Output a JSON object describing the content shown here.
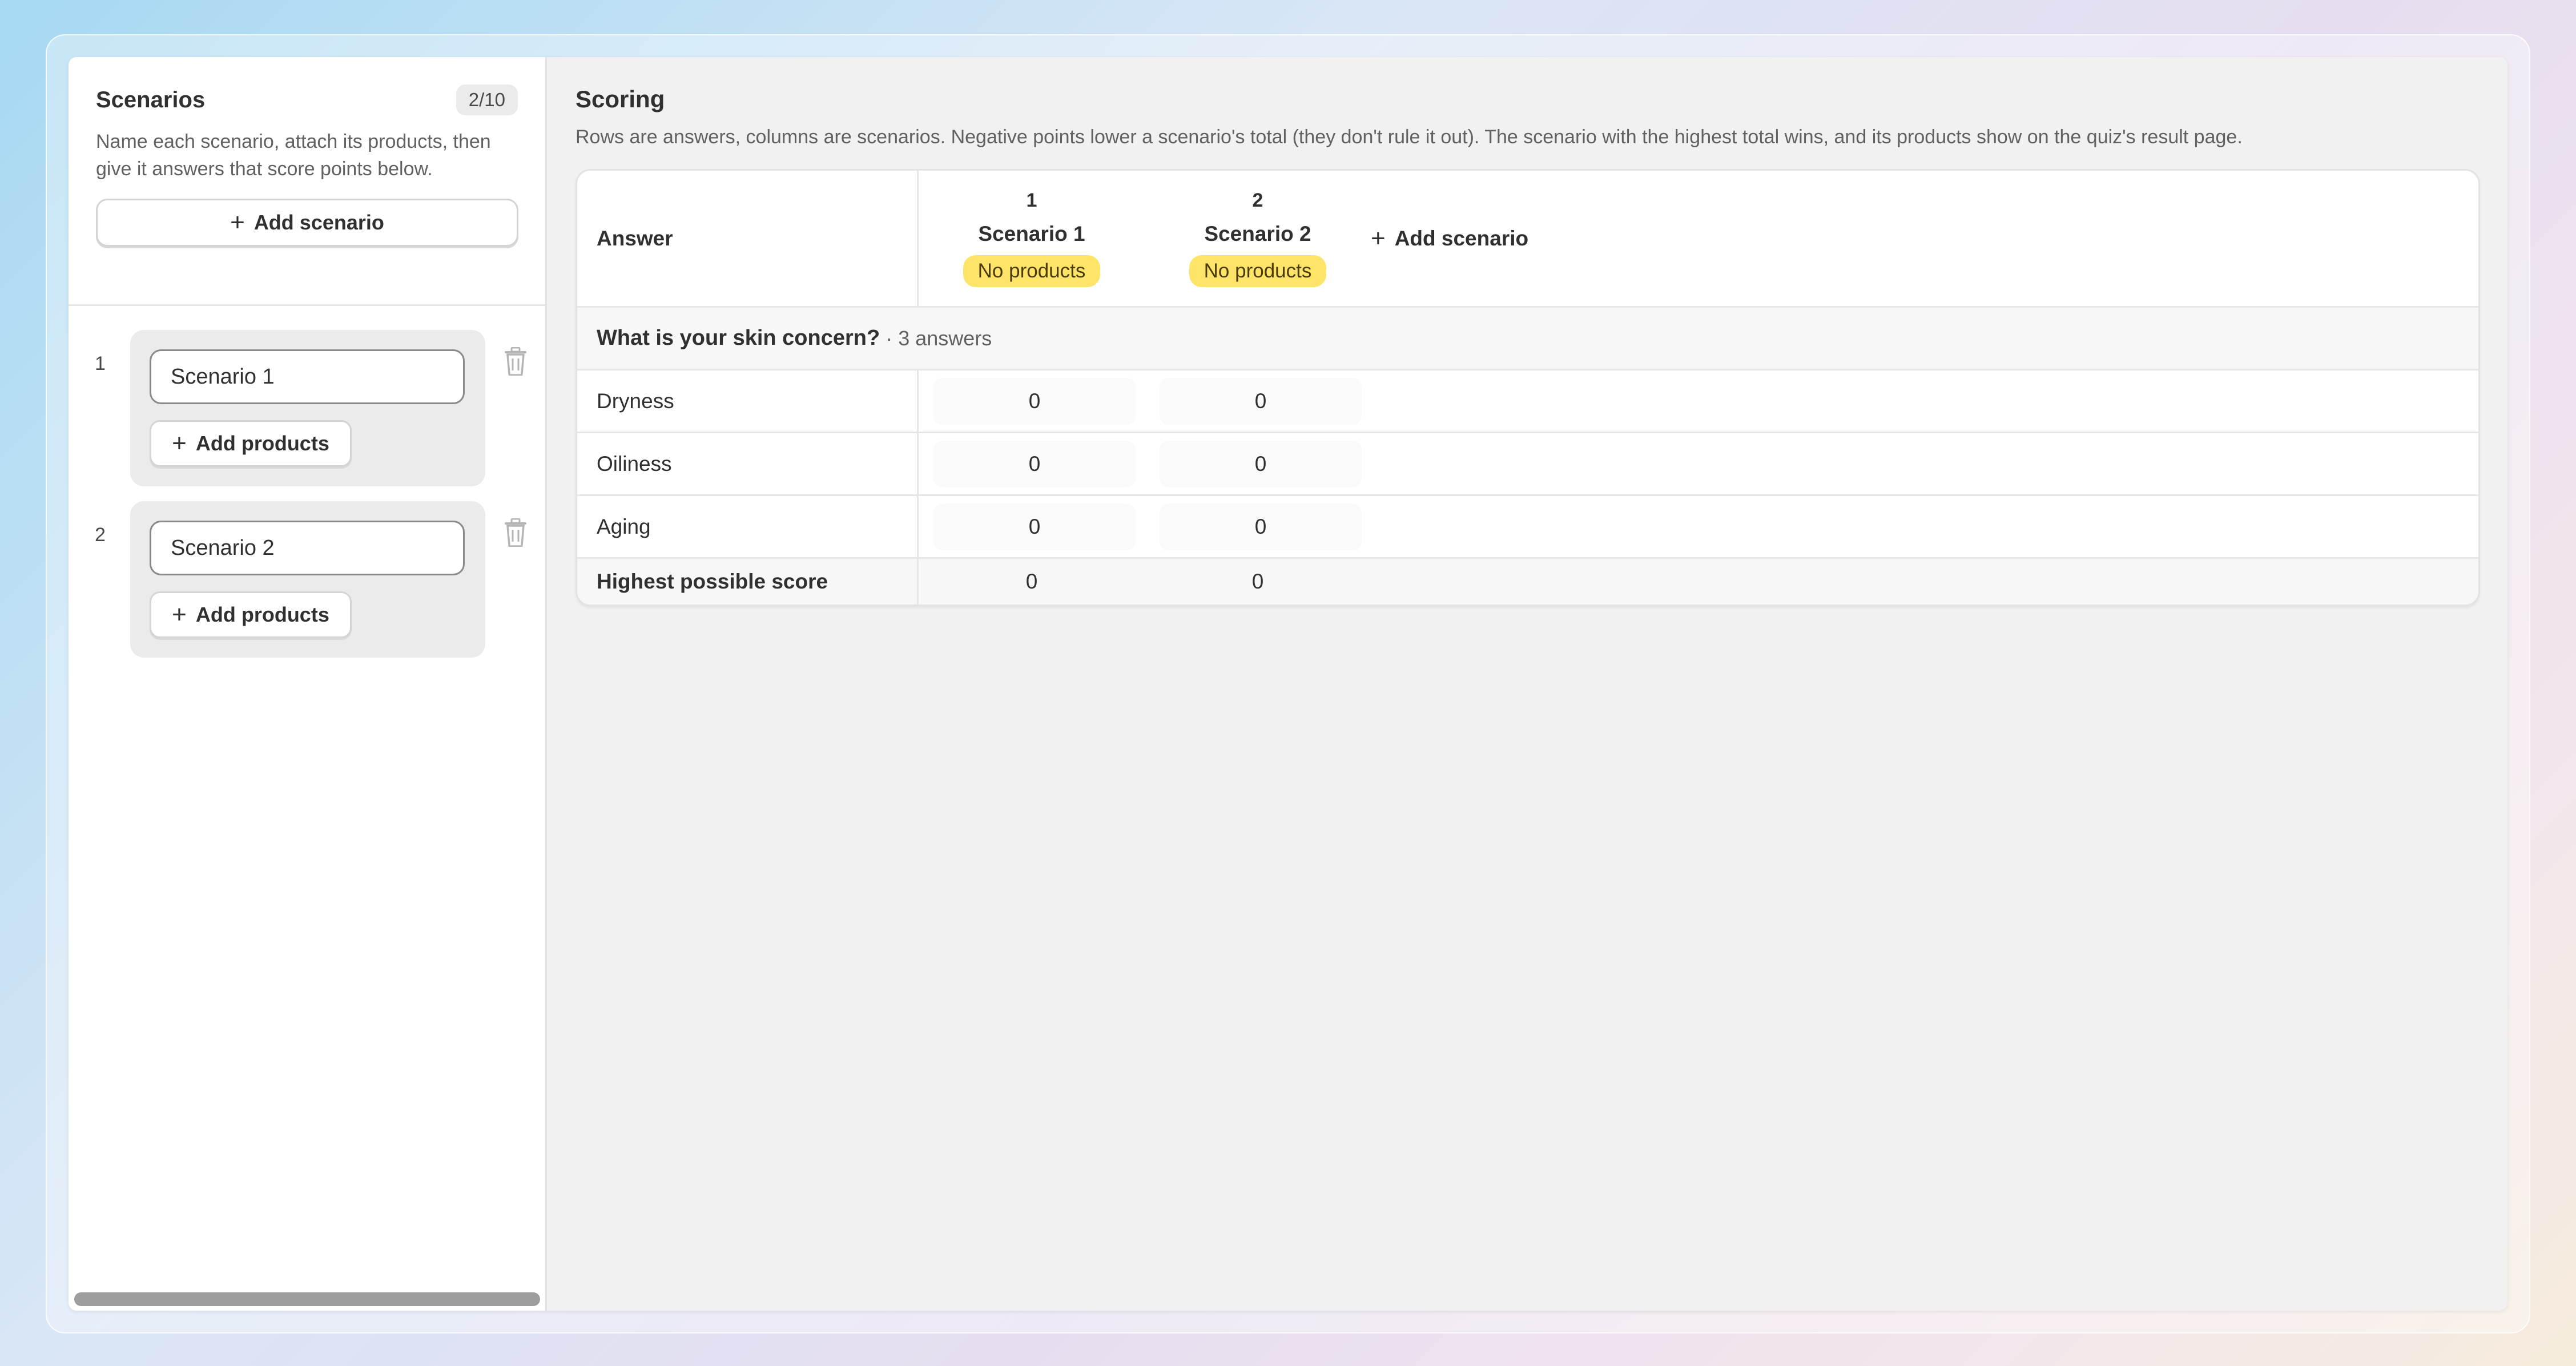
{
  "sidebar": {
    "title": "Scenarios",
    "count": "2/10",
    "description": "Name each scenario, attach its products, then give it answers that score points below.",
    "add_scenario_label": "Add scenario",
    "scenarios": [
      {
        "num": "1",
        "name": "Scenario 1",
        "add_products_label": "Add products"
      },
      {
        "num": "2",
        "name": "Scenario 2",
        "add_products_label": "Add products"
      }
    ]
  },
  "main": {
    "title": "Scoring",
    "description": "Rows are answers, columns are scenarios. Negative points lower a scenario's total (they don't rule it out). The scenario with the highest total wins, and its products show on the quiz's result page.",
    "table": {
      "answer_header": "Answer",
      "columns": [
        {
          "num": "1",
          "name": "Scenario 1",
          "badge": "No products"
        },
        {
          "num": "2",
          "name": "Scenario 2",
          "badge": "No products"
        }
      ],
      "add_scenario_label": "Add scenario",
      "group": {
        "question": "What is your skin concern?",
        "meta": "· 3 answers"
      },
      "answers": [
        {
          "label": "Dryness",
          "scores": [
            "0",
            "0"
          ]
        },
        {
          "label": "Oiliness",
          "scores": [
            "0",
            "0"
          ]
        },
        {
          "label": "Aging",
          "scores": [
            "0",
            "0"
          ]
        }
      ],
      "footer": {
        "label": "Highest possible score",
        "scores": [
          "0",
          "0"
        ]
      }
    }
  },
  "colors": {
    "badge": "#ffe46a",
    "background": "#f1f1f1"
  }
}
